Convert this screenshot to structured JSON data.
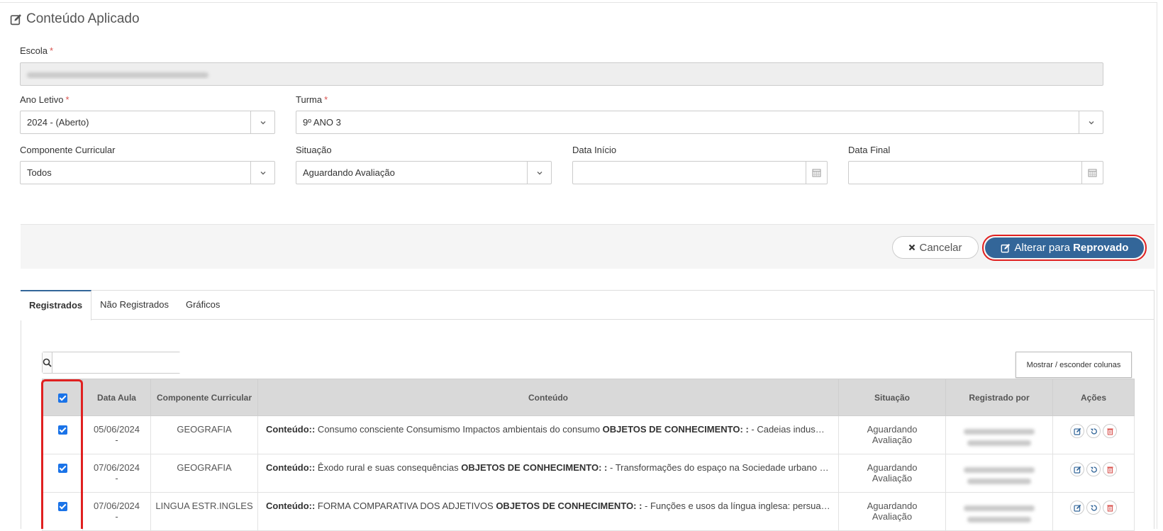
{
  "page": {
    "title": "Conteúdo Aplicado"
  },
  "form": {
    "escola_label": "Escola",
    "required_mark": "*",
    "ano_letivo_label": "Ano Letivo",
    "ano_letivo_value": "2024 - (Aberto)",
    "turma_label": "Turma",
    "turma_value": "9º ANO 3",
    "componente_label": "Componente Curricular",
    "componente_value": "Todos",
    "situacao_label": "Situação",
    "situacao_value": "Aguardando Avaliação",
    "data_inicio_label": "Data Início",
    "data_final_label": "Data Final"
  },
  "actions": {
    "cancel_label": "Cancelar",
    "primary_prefix": "Alterar para",
    "primary_bold": "Reprovado"
  },
  "tabs": [
    {
      "label": "Registrados",
      "active": true
    },
    {
      "label": "Não Registrados",
      "active": false
    },
    {
      "label": "Gráficos",
      "active": false
    }
  ],
  "toolbar": {
    "toggle_columns_label": "Mostrar / esconder colunas"
  },
  "table": {
    "headers": {
      "data_aula": "Data Aula",
      "componente": "Componente Curricular",
      "conteudo": "Conteúdo",
      "situacao": "Situação",
      "registrado_por": "Registrado por",
      "acoes": "Ações"
    },
    "rows": [
      {
        "date": "05/06/2024",
        "date_end": "-",
        "componente": "GEOGRAFIA",
        "conteudo_label": "Conteúdo::",
        "conteudo_text": " Consumo consciente Consumismo Impactos ambientais do consumo ",
        "objetos_label": "OBJETOS DE CONHECIMENTO: :",
        "objetos_text": " - Cadeias indus…",
        "situacao_line1": "Aguardando",
        "situacao_line2": "Avaliação"
      },
      {
        "date": "07/06/2024",
        "date_end": "-",
        "componente": "GEOGRAFIA",
        "conteudo_label": "Conteúdo::",
        "conteudo_text": " Êxodo rural e suas consequências ",
        "objetos_label": "OBJETOS DE CONHECIMENTO: :",
        "objetos_text": " - Transformações do espaço na Sociedade urbano …",
        "situacao_line1": "Aguardando",
        "situacao_line2": "Avaliação"
      },
      {
        "date": "07/06/2024",
        "date_end": "-",
        "componente": "LINGUA ESTR.INGLES",
        "conteudo_label": "Conteúdo::",
        "conteudo_text": " FORMA COMPARATIVA DOS ADJETIVOS ",
        "objetos_label": "OBJETOS DE CONHECIMENTO: :",
        "objetos_text": " - Funções e usos da língua inglesa: persuasão…",
        "situacao_line1": "Aguardando",
        "situacao_line2": "Avaliação"
      }
    ]
  },
  "colors": {
    "primary": "#336699",
    "highlight": "#e02020",
    "checkbox": "#1a73e8",
    "delete": "#d9534f"
  }
}
